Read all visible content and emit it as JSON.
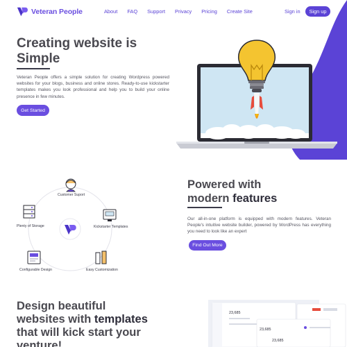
{
  "brand": {
    "name": "Veteran People",
    "accent": "#6a4ee0",
    "logo_icon": "vp-logo-icon"
  },
  "nav": {
    "links": [
      "About",
      "FAQ",
      "Support",
      "Privacy",
      "Pricing",
      "Create Site"
    ],
    "signin": "Sign in",
    "signup": "Sign up"
  },
  "hero": {
    "title_line1": "Creating website is",
    "title_line2": "Simple",
    "description": "Veteran People offers a simple solution for creating Wordpress powered websites for your blogs, business and online stores. Ready-to-use kickstarter templates makes you look professional and help you to build your online presence in few minutes.",
    "cta": "Get Started",
    "illustration_icons": [
      "laptop-icon",
      "lightbulb-icon",
      "rocket-icon"
    ]
  },
  "features": {
    "center_icon": "vp-logo-icon",
    "items": [
      {
        "label": "Customer Suport",
        "icon": "customer-support-icon"
      },
      {
        "label": "Kickstarter Templates",
        "icon": "templates-icon"
      },
      {
        "label": "Easy Customization",
        "icon": "customization-icon"
      },
      {
        "label": "Configurable Design",
        "icon": "configurable-design-icon"
      },
      {
        "label": "Plenty of Storage",
        "icon": "storage-icon"
      }
    ],
    "title_line1": "Powered with",
    "title_line2_a": "modern ",
    "title_line2_b": "features",
    "description": "Our all-in-one platform is equipped with modern features. Veteran People's intuitive website builder, powered by WordPress has everything you need to look like an expert",
    "cta": "Find Out More"
  },
  "templates_section": {
    "title_line1": "Design beautiful",
    "title_line2_a": "websites with ",
    "title_line2_b": "templates",
    "title_line3": "that will kick start your",
    "title_line4": "venture!",
    "dashboard_values": [
      "23,685",
      "23,685",
      "23,685"
    ]
  }
}
